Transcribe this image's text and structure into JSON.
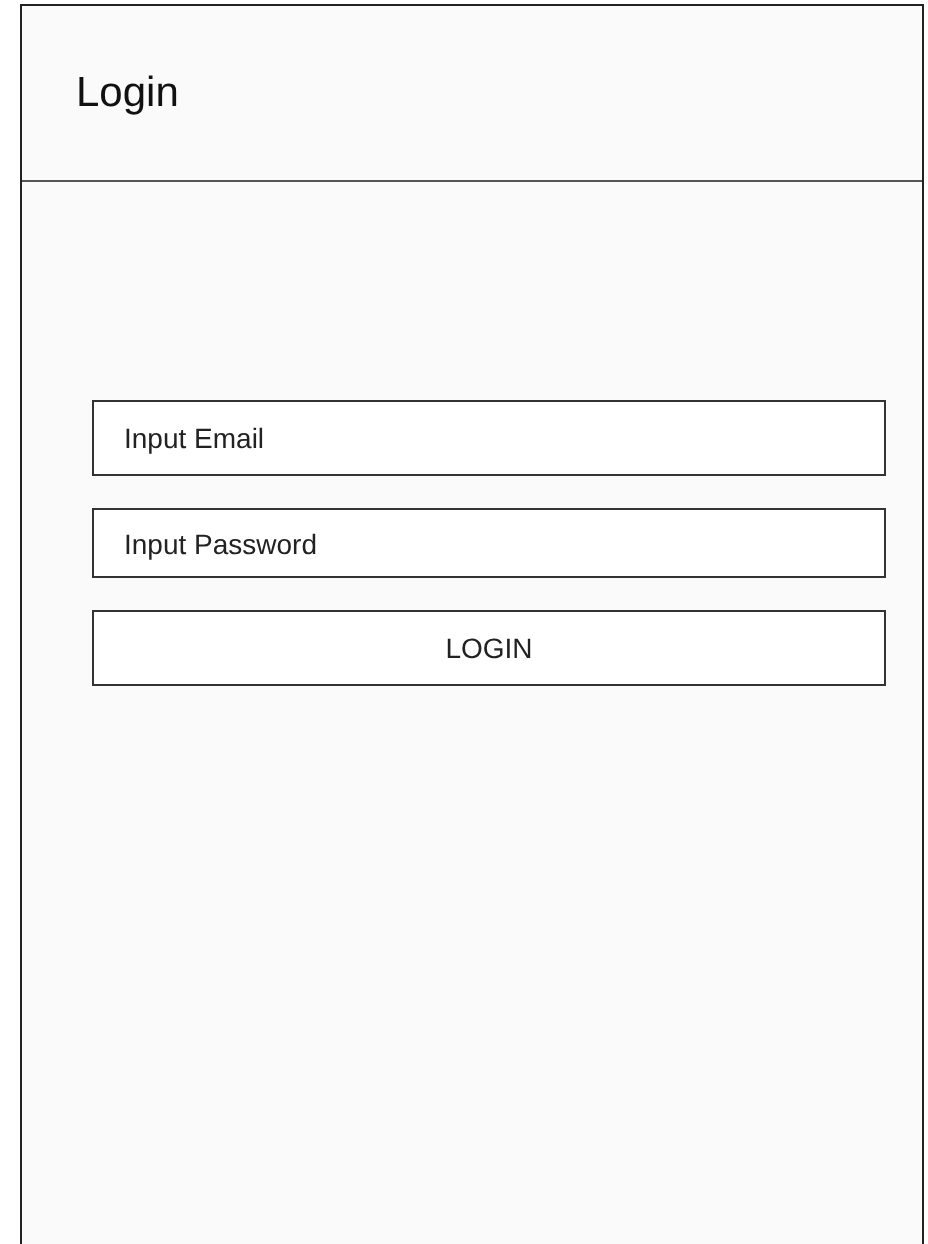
{
  "header": {
    "title": "Login"
  },
  "form": {
    "email": {
      "placeholder": "Input Email"
    },
    "password": {
      "placeholder": "Input Password"
    },
    "button": "LOGIN"
  }
}
